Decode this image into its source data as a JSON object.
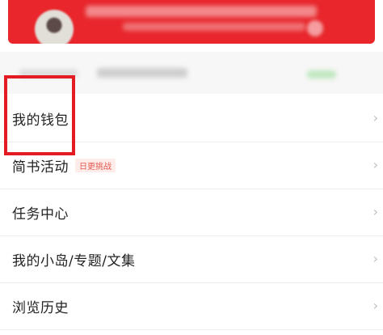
{
  "menu": {
    "items": [
      {
        "label": "我的钱包",
        "badge": ""
      },
      {
        "label": "简书活动",
        "badge": "日更挑战"
      },
      {
        "label": "任务中心",
        "badge": ""
      },
      {
        "label": "我的小岛/专题/文集",
        "badge": ""
      },
      {
        "label": "浏览历史",
        "badge": ""
      }
    ],
    "chevron": "›"
  },
  "colors": {
    "banner": "#e8262b",
    "highlight": "#e31c23",
    "badge_text": "#e85a4f"
  },
  "icons": [
    "chevron-right-icon"
  ]
}
